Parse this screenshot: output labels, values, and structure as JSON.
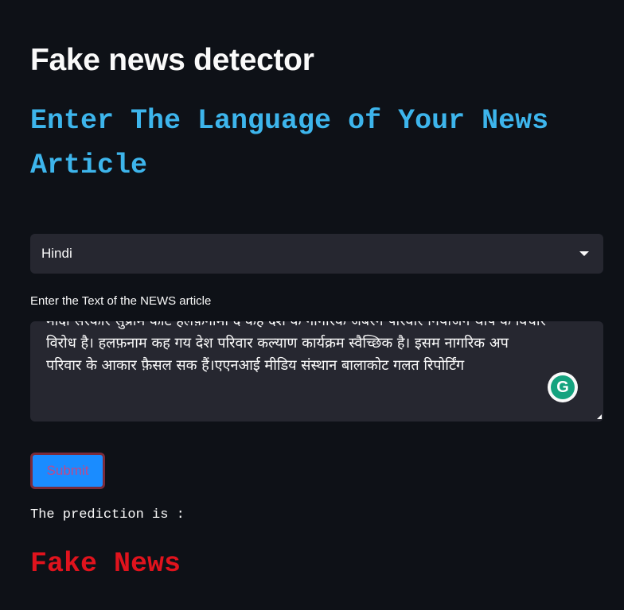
{
  "page": {
    "title": "Fake news detector",
    "language_heading": "Enter The Language of Your News Article"
  },
  "language_select": {
    "value": "Hindi",
    "icon": "chevron-down-icon"
  },
  "article_input": {
    "label": "Enter the Text of the NEWS article",
    "value": "मोदी सरकार सुप्रीम कोर्ट हलफ़नामा दे कह देश के नागरिक जबरन परिवार नियोजन थोप के विचार विरोध है। हलफ़नाम कह गय देश परिवार कल्याण कार्यक्रम स्वैच्छिक है। इसम नागरिक अप परिवार के आकार फ़ैसल सक हैं।एएनआई मीडिय संस्थान बालाकोट गलत रिपोर्टिंग",
    "grammarly_icon": "grammarly-icon",
    "grammarly_glyph": "G"
  },
  "submit": {
    "label": "Submit"
  },
  "result": {
    "label": "The prediction is :",
    "value": "Fake News"
  },
  "colors": {
    "background": "#0e1117",
    "heading": "#3db5ec",
    "input_bg": "#262730",
    "submit_bg": "#1a8cff",
    "result": "#e0131d"
  }
}
